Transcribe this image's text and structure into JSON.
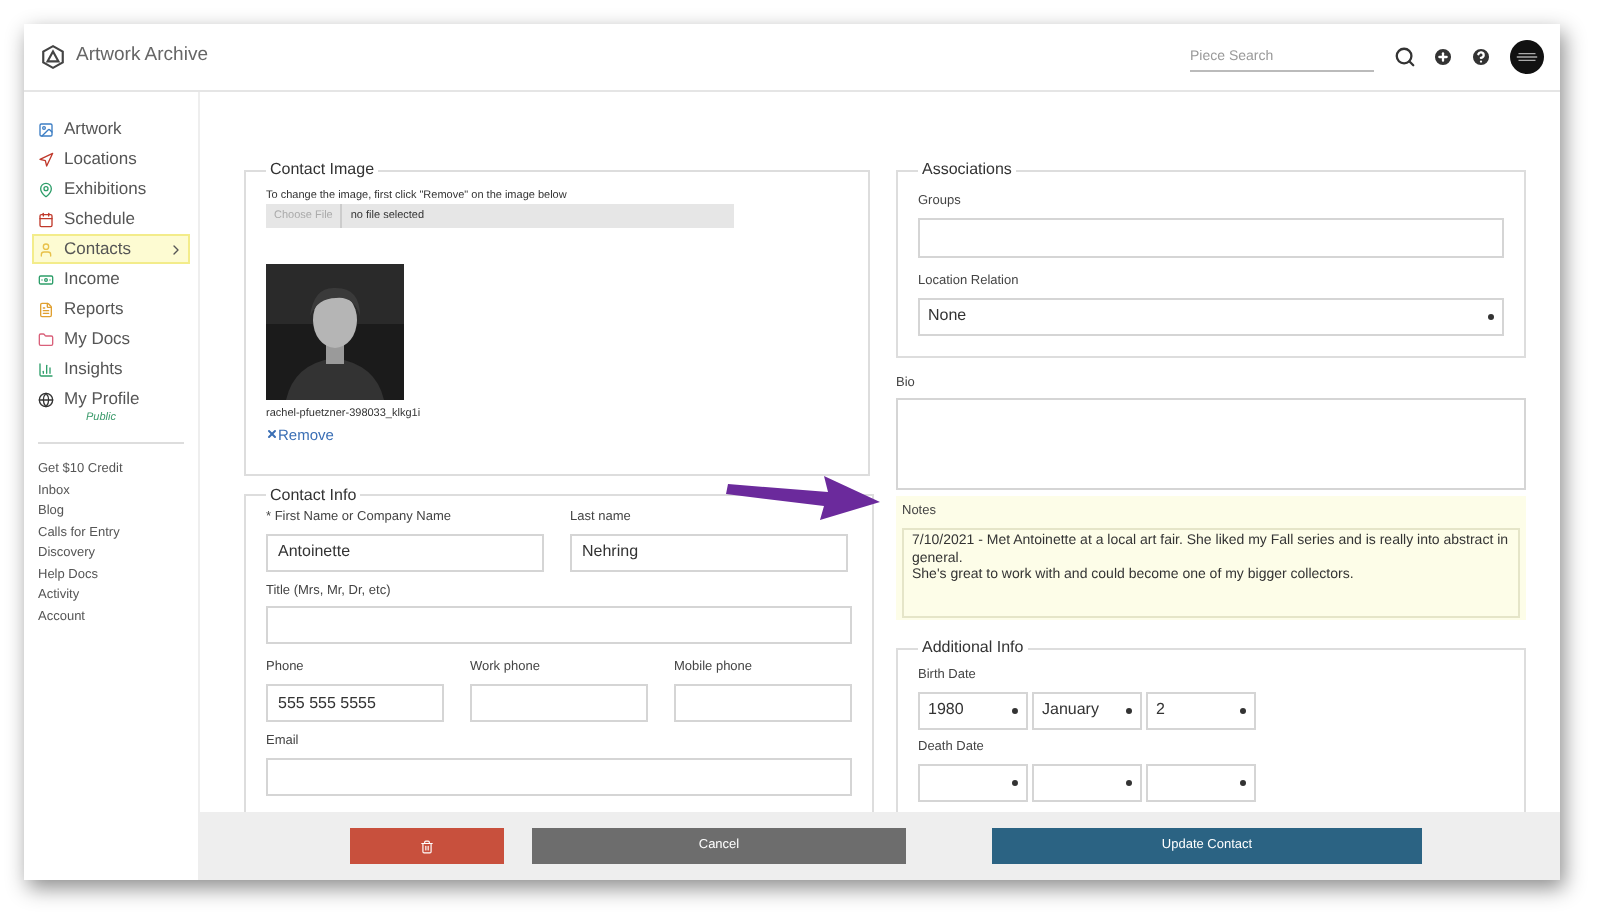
{
  "app": {
    "name": "Artwork Archive"
  },
  "search": {
    "placeholder": "Piece Search"
  },
  "sidebar": {
    "items": [
      {
        "label": "Artwork",
        "selected": false
      },
      {
        "label": "Locations",
        "selected": false
      },
      {
        "label": "Exhibitions",
        "selected": false
      },
      {
        "label": "Schedule",
        "selected": false
      },
      {
        "label": "Contacts",
        "selected": true
      },
      {
        "label": "Income",
        "selected": false
      },
      {
        "label": "Reports",
        "selected": false
      },
      {
        "label": "My Docs",
        "selected": false
      },
      {
        "label": "Insights",
        "selected": false
      },
      {
        "label": "My Profile",
        "selected": false,
        "sub": "Public"
      }
    ],
    "links": [
      "Get $10 Credit",
      "Inbox",
      "Blog",
      "Calls for Entry",
      "Discovery",
      "Help Docs",
      "Activity",
      "Account"
    ]
  },
  "contact_image": {
    "title": "Contact Image",
    "hint": "To change the image, first click \"Remove\" on the image below",
    "file_button": "Choose File",
    "file_status": "no file selected",
    "filename": "rachel-pfuetzner-398033_klkg1i",
    "remove": "Remove"
  },
  "contact_info": {
    "title": "Contact Info",
    "fields": [
      {
        "label": "* First Name or Company Name",
        "value": "Antoinette"
      },
      {
        "label": "Last name",
        "value": "Nehring"
      },
      {
        "label": "Title (Mrs, Mr, Dr, etc)"
      },
      {
        "label": "Phone",
        "value": "555 555 5555"
      },
      {
        "label": "Work phone"
      },
      {
        "label": "Mobile phone"
      },
      {
        "label": "Email"
      }
    ]
  },
  "associations": {
    "title": "Associations",
    "groups_label": "Groups",
    "location_label": "Location Relation",
    "location_value": "None"
  },
  "bio": {
    "label": "Bio"
  },
  "notes": {
    "label": "Notes",
    "lines": [
      "7/10/2021 - Met Antoinette at a local art fair. She liked my Fall series and is really into abstract in general.",
      "She's great to work with and could  become one of my bigger collectors."
    ]
  },
  "additional_info": {
    "title": "Additional Info",
    "birth_label": "Birth Date",
    "birth": [
      "1980",
      "January",
      "2"
    ],
    "death_label": "Death Date"
  },
  "buttons": {
    "cancel": "Cancel",
    "update": "Update Contact"
  }
}
